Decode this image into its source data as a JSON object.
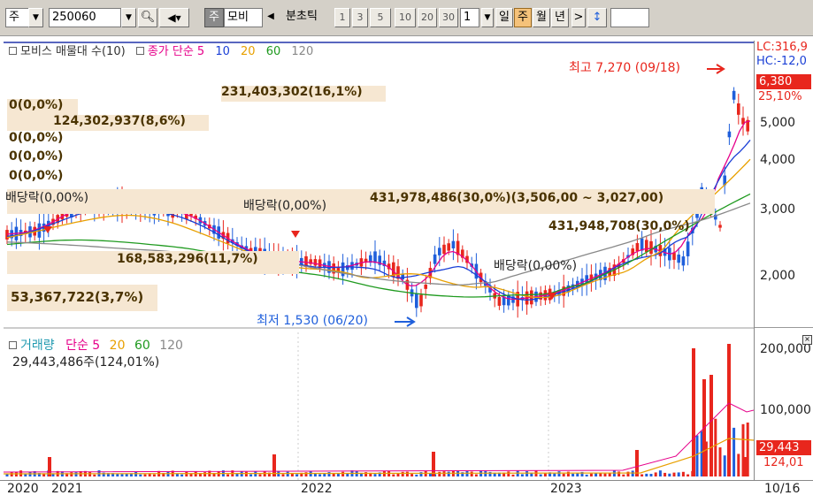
{
  "toolbar": {
    "period_select": "주",
    "stock_code": "250060",
    "stock_name_badge": "주",
    "stock_name": "모비",
    "options_label": "분초틱",
    "intervals": [
      "1",
      "3",
      "5",
      "10",
      "20",
      "30"
    ],
    "count_value": "1",
    "period_tabs": [
      {
        "label": "일",
        "active": false
      },
      {
        "label": "주",
        "active": true
      },
      {
        "label": "월",
        "active": false
      },
      {
        "label": "년",
        "active": false
      }
    ],
    "next_label": ">",
    "updown_label": "↕"
  },
  "price_panel": {
    "legend": {
      "title": "모비스 매물대 수(10)",
      "ma_label": "종가 단순 5",
      "periods": [
        "10",
        "20",
        "60",
        "120"
      ],
      "colors": {
        "5": "#e6008a",
        "10": "#1a3fd6",
        "20": "#e8a000",
        "60": "#1f9a1f",
        "120": "#888888"
      }
    },
    "right_labels": {
      "lc": "LC:316,9",
      "hc": "HC:-12,0",
      "price": "6,380",
      "pct": "25,10%"
    },
    "y_ticks": [
      "5,000",
      "4,000",
      "3,000",
      "2,000"
    ],
    "high_annotation": "최고 7,270 (09/18)",
    "low_annotation": "최저 1,530 (06/20)",
    "dividend_labels": [
      "배당락(0,00%)",
      "배당락(0,00%)",
      "배당락(0,00%)"
    ],
    "volume_profile": [
      {
        "text": "231,403,302(16,1%)"
      },
      {
        "text": "0(0,0%)"
      },
      {
        "text": "124,302,937(8,6%)"
      },
      {
        "text": "0(0,0%)"
      },
      {
        "text": "0(0,0%)"
      },
      {
        "text": "0(0,0%)"
      },
      {
        "text": "431,978,486(30,0%)(3,506,00 ~ 3,027,00)"
      },
      {
        "text": "431,948,708(30,0%)"
      },
      {
        "text": "168,583,296(11,7%)"
      },
      {
        "text": "53,367,722(3,7%)"
      }
    ]
  },
  "volume_panel": {
    "legend_title": "거래량",
    "ma_label": "단순 5",
    "periods": [
      "20",
      "60",
      "120"
    ],
    "value_text": "29,443,486주(124,01%)",
    "y_ticks": [
      "200,000",
      "100,000"
    ],
    "tag_value": "29,443",
    "tag_pct": "124,01"
  },
  "x_axis": {
    "labels": [
      "2020",
      "2021",
      "2022",
      "2023"
    ],
    "date_label": "10/16"
  },
  "colors": {
    "up": "#e8261d",
    "down": "#1f5fdb",
    "band": "#f6e7d2",
    "active_tab": "#f5c27a",
    "price_tag": "#e8261d"
  }
}
